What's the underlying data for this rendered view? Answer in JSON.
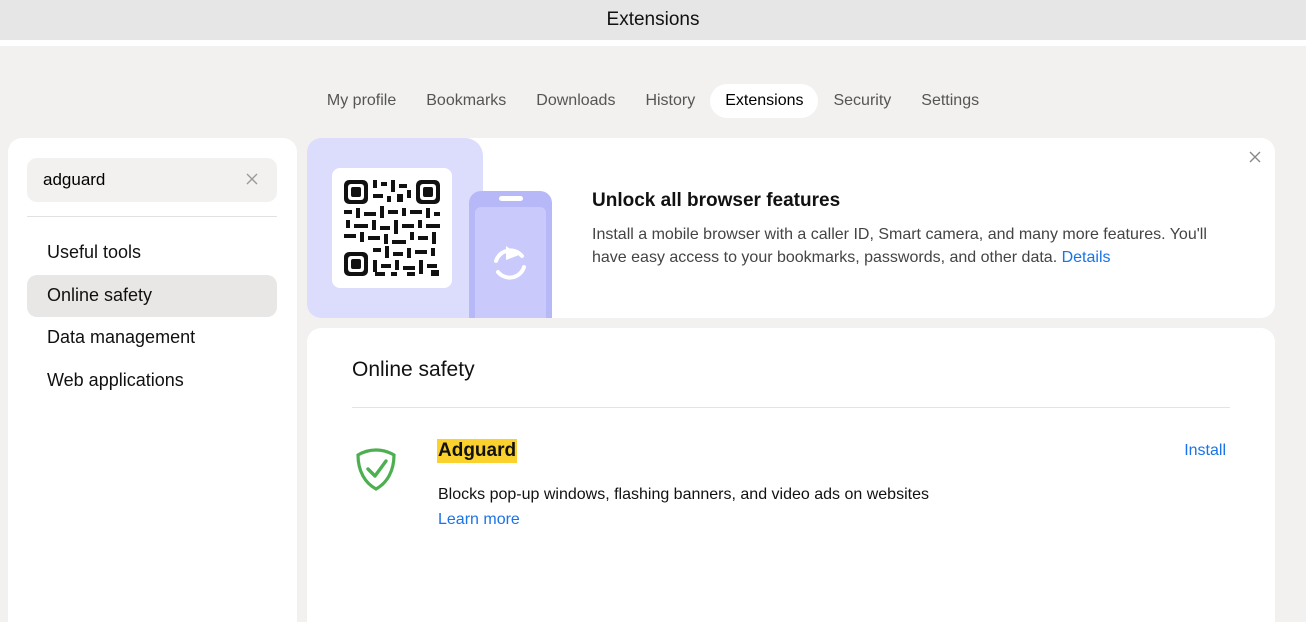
{
  "window": {
    "title": "Extensions"
  },
  "nav": {
    "tabs": [
      {
        "label": "My profile"
      },
      {
        "label": "Bookmarks"
      },
      {
        "label": "Downloads"
      },
      {
        "label": "History"
      },
      {
        "label": "Extensions",
        "active": true
      },
      {
        "label": "Security"
      },
      {
        "label": "Settings"
      }
    ]
  },
  "sidebar": {
    "search": {
      "value": "adguard"
    },
    "items": [
      {
        "label": "Useful tools"
      },
      {
        "label": "Online safety",
        "active": true
      },
      {
        "label": "Data management"
      },
      {
        "label": "Web applications"
      }
    ]
  },
  "banner": {
    "title": "Unlock all browser features",
    "description": "Install a mobile browser with a caller ID, Smart camera, and many more features. You'll have easy access to your bookmarks, passwords, and other data.",
    "link": "Details"
  },
  "section": {
    "title": "Online safety",
    "extension": {
      "name": "Adguard",
      "action": "Install",
      "description": "Blocks pop-up windows, flashing banners, and video ads on websites",
      "learn_more": "Learn more",
      "icon": "shield-check-icon"
    }
  },
  "colors": {
    "accent_link": "#1a73e8",
    "highlight": "#fbd12e",
    "banner_art": "#c8c9fb",
    "shield_green": "#4caf50"
  }
}
